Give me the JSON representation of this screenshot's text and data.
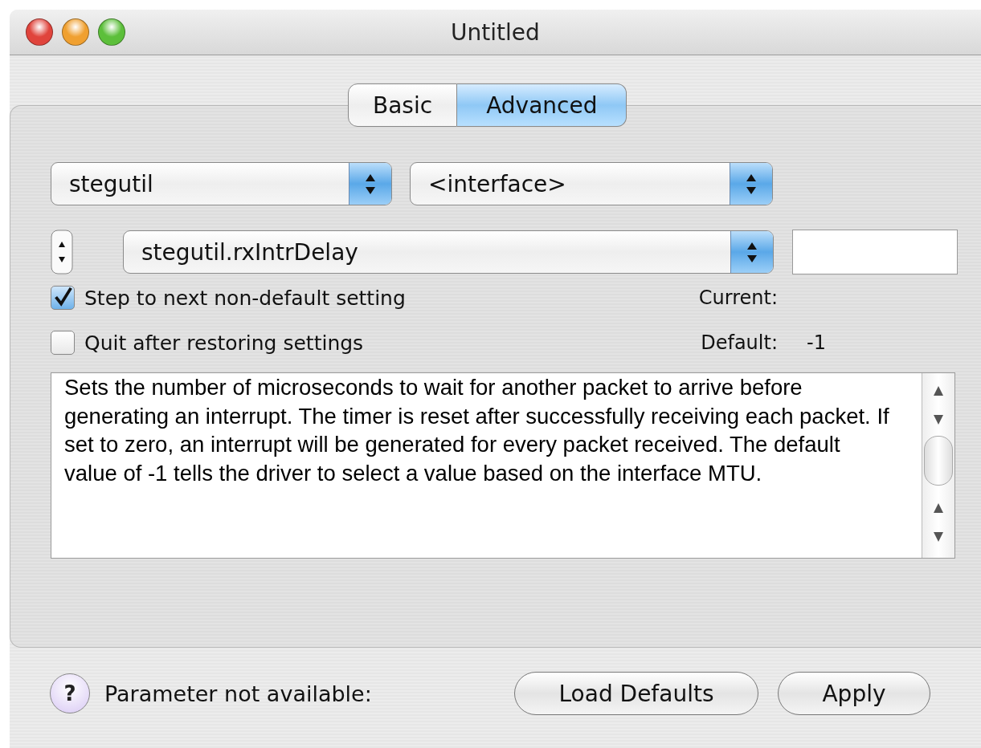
{
  "window": {
    "title": "Untitled"
  },
  "tabs": [
    {
      "label": "Basic",
      "selected": false
    },
    {
      "label": "Advanced",
      "selected": true
    }
  ],
  "module_popup": {
    "value": "stegutil"
  },
  "interface_popup": {
    "value": "<interface>"
  },
  "parameter_popup": {
    "value": "stegutil.rxIntrDelay"
  },
  "checkboxes": [
    {
      "label": "Step to next non-default setting",
      "checked": true
    },
    {
      "label": "Quit after restoring settings",
      "checked": false
    }
  ],
  "current": {
    "label": "Current:"
  },
  "default": {
    "label": "Default:",
    "value": "-1"
  },
  "description": "Sets the number of microseconds to wait for another packet to arrive before generating an interrupt. The timer is reset after successfully receiving each packet. If set to zero, an interrupt will be generated for every packet received. The default value of -1 tells the driver to select a value based on the interface MTU.",
  "help": {
    "label": "?"
  },
  "status": "Parameter not available:",
  "buttons": [
    "Load Defaults",
    "Apply"
  ]
}
